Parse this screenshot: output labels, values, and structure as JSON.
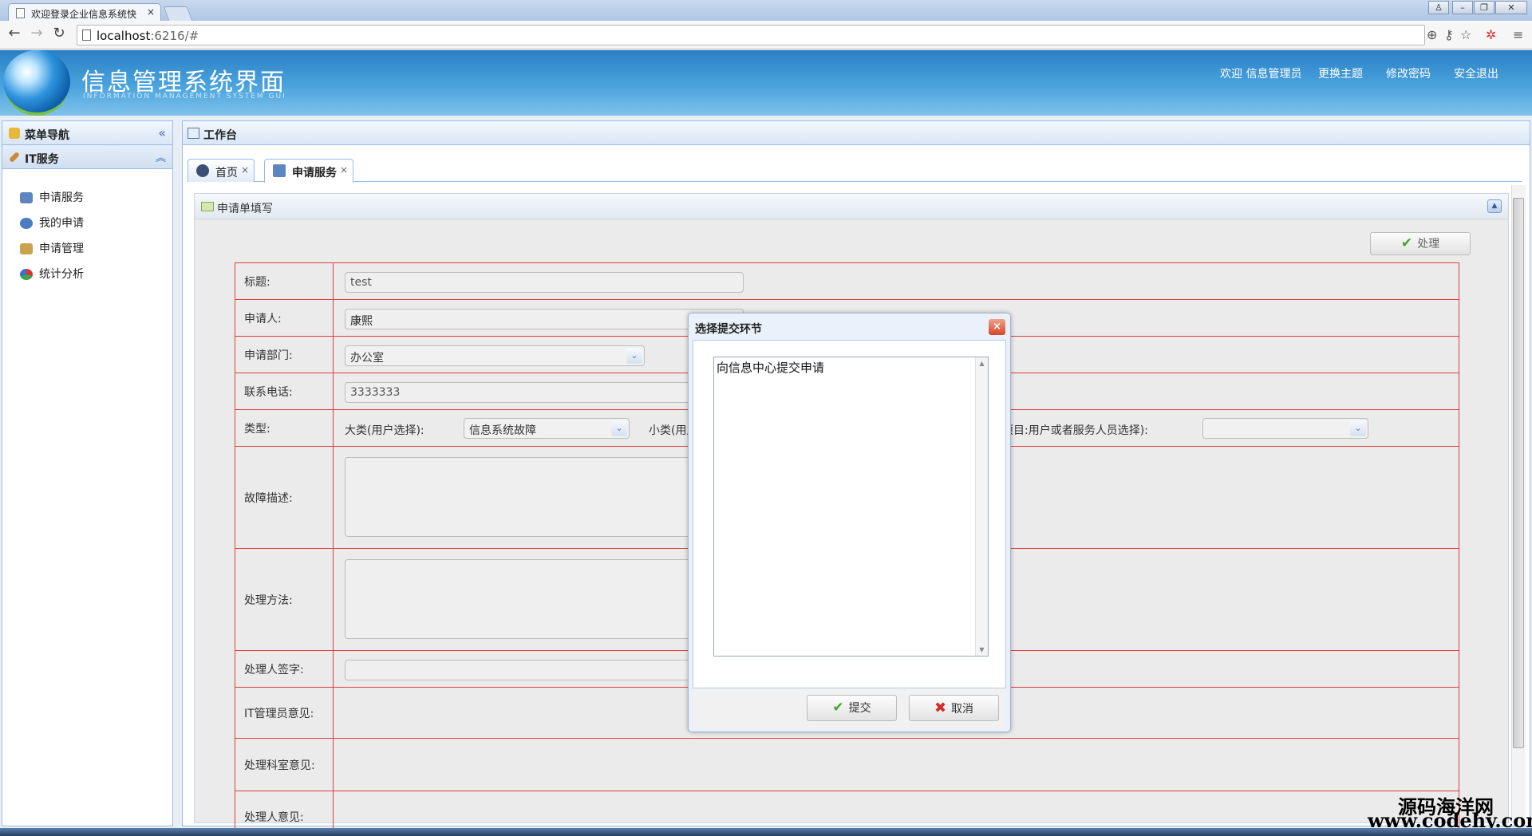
{
  "browser": {
    "tab_title": "欢迎登录企业信息系统快",
    "tab_close": "×",
    "url_host": "localhost",
    "url_rest": ":6216/#",
    "window_buttons": [
      "♙",
      "–",
      "❐",
      "✕"
    ]
  },
  "header": {
    "title": "信息管理系统界面",
    "subtitle": "INFORMATION MANAGEMENT SYSTEM GUI",
    "welcome": "欢迎 信息管理员",
    "change_theme": "更换主题",
    "change_password": "修改密码",
    "logout": "安全退出"
  },
  "sidebar": {
    "title": "菜单导航",
    "collapse_glyph": "«",
    "section": "IT服务",
    "section_glyph": "︽",
    "items": [
      {
        "label": "申请服务",
        "icon": "form-icon",
        "color": "#5d86c0"
      },
      {
        "label": "我的申请",
        "icon": "users-icon",
        "color": "#4a7bc4"
      },
      {
        "label": "申请管理",
        "icon": "manage-icon",
        "color": "#c9a24b"
      },
      {
        "label": "统计分析",
        "icon": "pie-chart-icon",
        "color": "#3fa34d"
      }
    ]
  },
  "workspace": {
    "title": "工作台",
    "tabs": [
      {
        "label": "首页",
        "close": "×"
      },
      {
        "label": "申请服务",
        "close": "×"
      }
    ]
  },
  "form": {
    "panel_title": "申请单填写",
    "process_button": "处理",
    "check_glyph": "✔",
    "collapse_glyph": "▲",
    "select_arrow": "⌄",
    "labels": {
      "title": "标题:",
      "applicant": "申请人:",
      "department": "申请部门:",
      "phone": "联系电话:",
      "type": "类型:",
      "fault_desc": "故障描述:",
      "method": "处理方法:",
      "signature": "处理人签字:",
      "it_admin": "IT管理员意见:",
      "dept_opinion": "处理科室意见:",
      "handler_opinion": "处理人意见:"
    },
    "values": {
      "title": "test",
      "applicant": "康熙",
      "department": "办公室",
      "phone": "3333333"
    },
    "type_row": {
      "major_label": "大类(用户选择):",
      "major_value": "信息系统故障",
      "minor_label": "小类(用户",
      "item_label": "项目:用户或者服务人员选择):"
    }
  },
  "dialog": {
    "title": "选择提交环节",
    "close_glyph": "×",
    "list_items": [
      "向信息中心提交申请"
    ],
    "scroll_up": "▲",
    "scroll_down": "▼",
    "submit": "提交",
    "cancel": "取消",
    "cancel_glyph": "✖"
  },
  "watermark": {
    "line1": "源码海洋网",
    "line2": "www.codehy.com"
  },
  "colors": {
    "header_blue": "#2a7fc4",
    "panel_border": "#99bbe8",
    "form_line_red": "#e23c3c"
  }
}
